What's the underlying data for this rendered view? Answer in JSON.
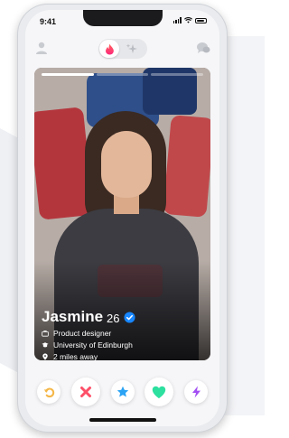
{
  "status_bar": {
    "time": "9:41"
  },
  "profile": {
    "name": "Jasmine",
    "age": "26",
    "verified": true,
    "details": [
      {
        "icon": "briefcase-icon",
        "text": "Product designer"
      },
      {
        "icon": "graduation-cap-icon",
        "text": "University of Edinburgh"
      },
      {
        "icon": "location-pin-icon",
        "text": "2 miles away"
      }
    ],
    "photo_count": 3,
    "active_photo": 1
  },
  "top_bar": {
    "left_icon": "profile-icon",
    "center_icons": [
      "flame-icon",
      "sparkle-icon"
    ],
    "right_icon": "chat-icon"
  },
  "actions": [
    {
      "name": "rewind-button",
      "icon": "rewind-icon",
      "color": "#f5b748"
    },
    {
      "name": "nope-button",
      "icon": "close-icon",
      "color": "#fd4f68"
    },
    {
      "name": "super-like-button",
      "icon": "star-icon",
      "color": "#2aa3f4"
    },
    {
      "name": "like-button",
      "icon": "heart-icon",
      "color": "#2de0a0"
    },
    {
      "name": "boost-button",
      "icon": "lightning-icon",
      "color": "#a24ef2"
    }
  ],
  "colors": {
    "brand": "#fd5068",
    "verified": "#1786ff"
  }
}
